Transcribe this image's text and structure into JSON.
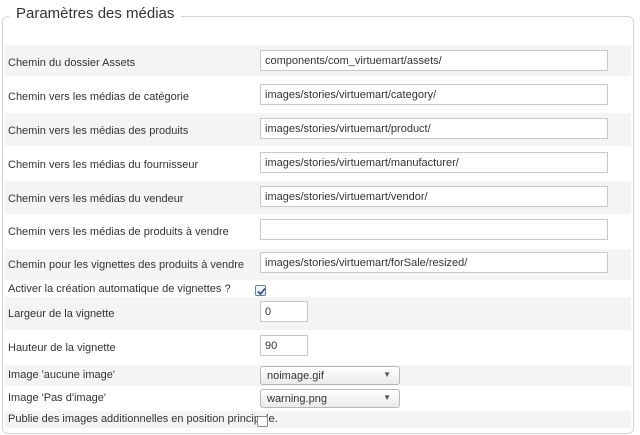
{
  "section": {
    "title": "Paramètres des médias"
  },
  "fields": [
    {
      "label": "Chemin du dossier Assets",
      "value": "components/com_virtuemart/assets/"
    },
    {
      "label": "Chemin vers les médias de catégorie",
      "value": "images/stories/virtuemart/category/"
    },
    {
      "label": "Chemin vers les médias des produits",
      "value": "images/stories/virtuemart/product/"
    },
    {
      "label": "Chemin vers les médias du fournisseur",
      "value": "images/stories/virtuemart/manufacturer/"
    },
    {
      "label": "Chemin vers les médias du vendeur",
      "value": "images/stories/virtuemart/vendor/"
    },
    {
      "label": "Chemin vers les médias de produits à vendre",
      "value": ""
    },
    {
      "label": "Chemin pour les vignettes des produits à vendre",
      "value": "images/stories/virtuemart/forSale/resized/"
    }
  ],
  "auto_thumb": {
    "label": "Activer la création automatique de vignettes ?",
    "checked": true
  },
  "thumb_width": {
    "label": "Largeur de la vignette",
    "value": "0"
  },
  "thumb_height": {
    "label": "Hauteur de la vignette",
    "value": "90"
  },
  "no_image": {
    "label": "Image 'aucune image'",
    "selected": "noimage.gif"
  },
  "warning_image": {
    "label": "Image 'Pas d'image'",
    "selected": "warning.png"
  },
  "publish_additional": {
    "label": "Publie des images additionnelles en position principale.",
    "checked": false
  },
  "icons": {
    "dropdown": "chevron-down-icon",
    "checkmark": "checkmark-icon"
  }
}
